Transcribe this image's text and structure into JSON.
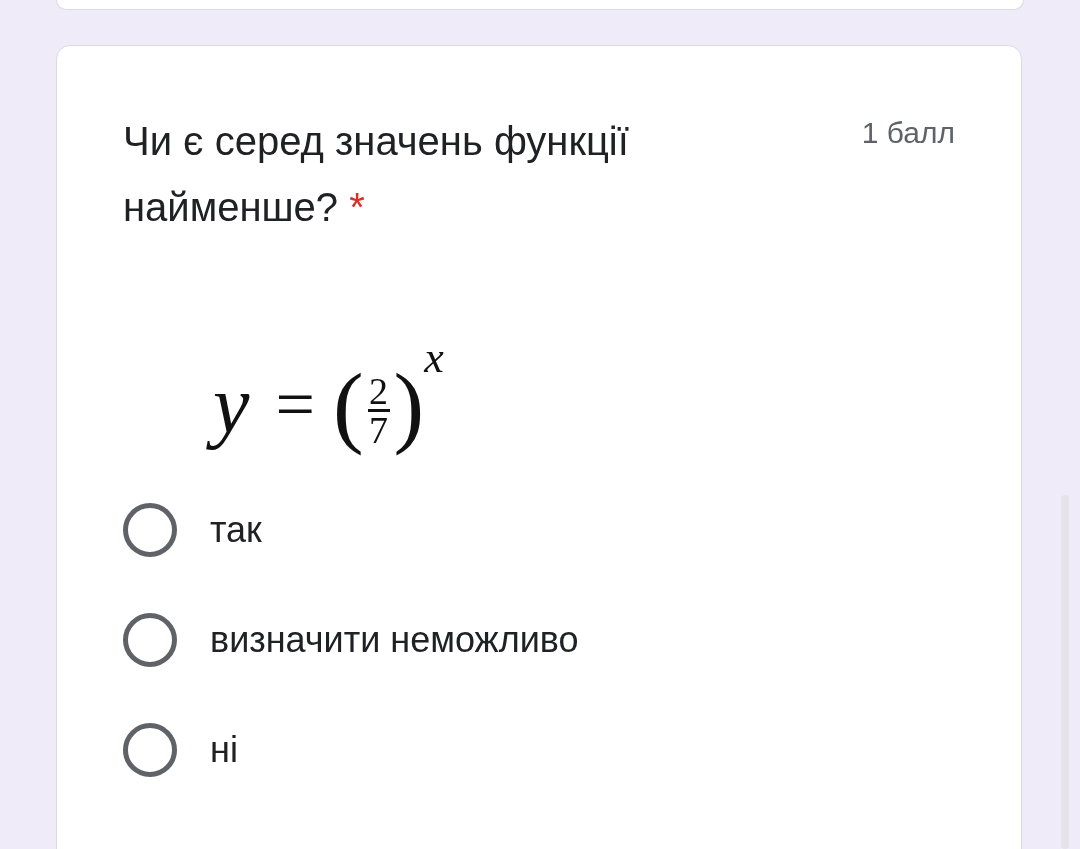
{
  "question": {
    "text": "Чи є серед значень функції найменше?",
    "required": true,
    "required_mark": "*",
    "points": "1 балл"
  },
  "formula": {
    "lhs": "y",
    "equals": "=",
    "open": "(",
    "numerator": "2",
    "denominator": "7",
    "close": ")",
    "exponent": "x"
  },
  "options": [
    {
      "label": "так",
      "selected": false
    },
    {
      "label": "визначити неможливо",
      "selected": false
    },
    {
      "label": "ні",
      "selected": false
    }
  ]
}
